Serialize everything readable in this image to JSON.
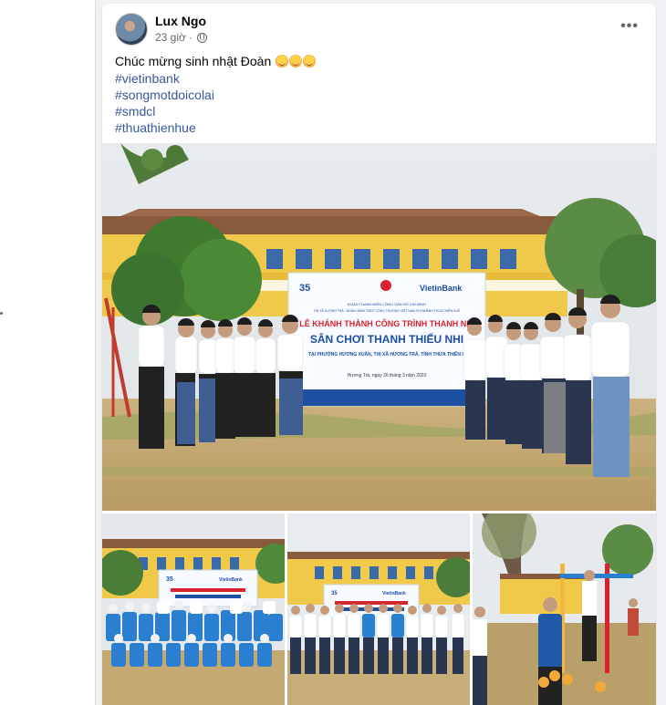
{
  "post": {
    "author": "Lux Ngo",
    "time": "23 giờ",
    "separator": "·",
    "more_icon": "more-horizontal-icon",
    "privacy_icon": "globe-icon",
    "caption": "Chúc mừng sinh nhật Đoàn",
    "caption_emojis": [
      "smiling-face-with-hearts",
      "smiling-face-with-hearts",
      "smiling-face-with-hearts"
    ],
    "hashtags": [
      "#vietinbank",
      "#songmotdoicolai",
      "#smdcl",
      "#thuathienhue"
    ]
  },
  "photos": {
    "main_banner": {
      "logo_number": "35",
      "brand": "VietinBank",
      "org_line1": "ĐOÀN THANH NIÊN CỘNG SẢN HỒ CHÍ MINH",
      "org_line2": "THỊ XÃ HƯƠNG TRÀ - NGÂN HÀNG TMCP CÔNG THƯƠNG VIỆT NAM CHI NHÁNH THỪA THIÊN HUẾ",
      "title_line1": "LỄ KHÁNH THÀNH CÔNG TRÌNH THANH NIÊ",
      "title_line2": "SÂN CHƠI THANH THIẾU NHI",
      "location": "TẠI PHƯỜNG HƯƠNG XUÂN, THỊ XÃ HƯƠNG TRÀ, TỈNH THỪA THIÊN H",
      "date": "Hương Trà, ngày 26 tháng 3 năm 2023"
    },
    "thumb_banner": {
      "logo_number": "35",
      "brand": "VietinBank"
    }
  },
  "colors": {
    "link": "#385898",
    "banner_title": "#d9232e",
    "banner_blue": "#1d4fa3"
  }
}
